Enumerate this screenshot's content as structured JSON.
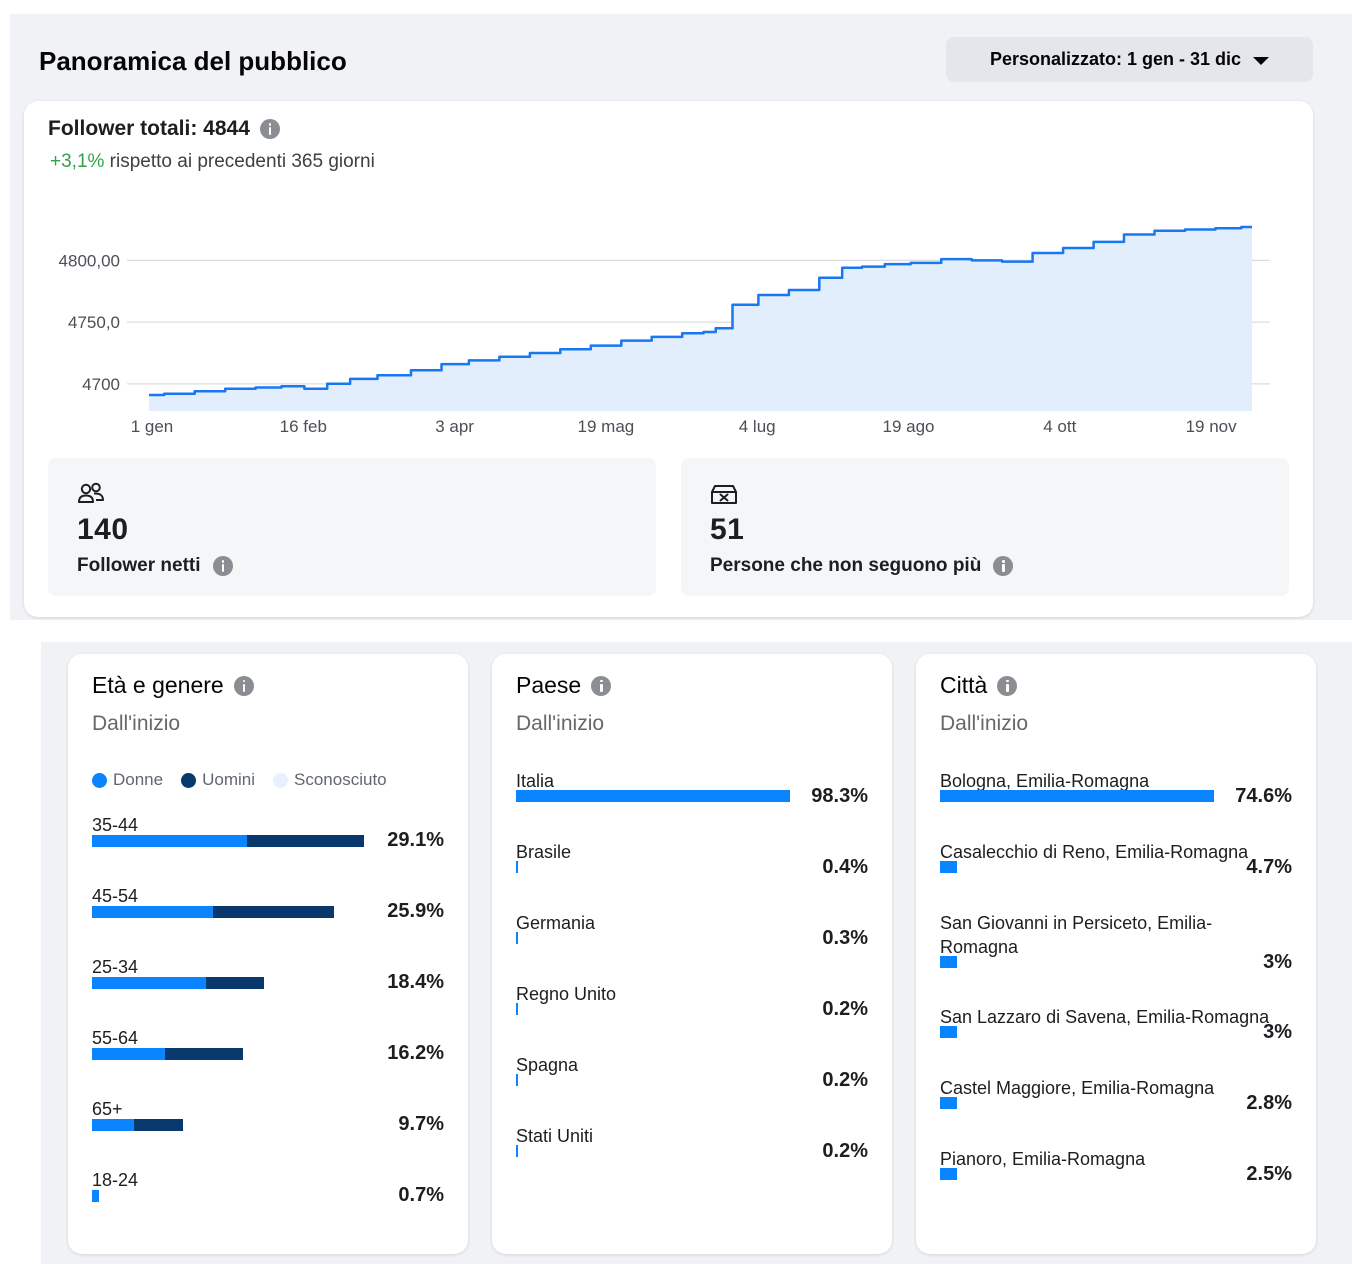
{
  "header": {
    "title": "Panoramica del pubblico",
    "date_range": "Personalizzato: 1 gen - 31 dic"
  },
  "overview": {
    "followers_total": "Follower totali: 4844",
    "change_positive": "+3,1%",
    "change_rest": " rispetto ai precedenti 365 giorni"
  },
  "chart_data": {
    "type": "area",
    "title": "",
    "xlabel": "",
    "ylabel": "",
    "x_ticks": [
      "1 gen",
      "16 feb",
      "3 apr",
      "19 mag",
      "4 lug",
      "19 ago",
      "4 ott",
      "19 nov"
    ],
    "y_ticks": [
      "4700",
      "4750,0",
      "4800,00"
    ],
    "y_tick_values": [
      4700,
      4750,
      4800
    ],
    "ylim": [
      4678,
      4840
    ],
    "grid": true,
    "series": [
      {
        "x_day": [
          0,
          10,
          20,
          30,
          40,
          47,
          55,
          62,
          70,
          80,
          92,
          100,
          110,
          120,
          130,
          140,
          150,
          160,
          170,
          180,
          184,
          188,
          195,
          205,
          215,
          225,
          230,
          238,
          245,
          255,
          265,
          275,
          285,
          295,
          305,
          315,
          325,
          335,
          345,
          355,
          362
        ],
        "values": [
          4691,
          4692,
          4694,
          4696,
          4697,
          4698,
          4696,
          4700,
          4704,
          4707,
          4711,
          4716,
          4719,
          4722,
          4725,
          4728,
          4731,
          4735,
          4738,
          4741,
          4742,
          4745,
          4764,
          4772,
          4776,
          4786,
          4794,
          4795,
          4797,
          4798,
          4801,
          4800,
          4799,
          4806,
          4810,
          4815,
          4821,
          4824,
          4825,
          4826,
          4827
        ]
      }
    ],
    "colors": {
      "line": "#1877f2",
      "fill": "#e3eefc"
    }
  },
  "stats": {
    "net": {
      "value": "140",
      "label": "Follower netti",
      "icon": "people-icon"
    },
    "unfollow": {
      "value": "51",
      "label": "Persone che non seguono più",
      "icon": "unfollow-box-icon"
    }
  },
  "age_gender": {
    "title": "Età e genere",
    "subtitle": "Dall'inizio",
    "legend": {
      "women": "Donne",
      "men": "Uomini",
      "unknown": "Sconosciuto"
    },
    "colors": {
      "women": "#0a84ff",
      "men": "#08386c",
      "unknown": "#e7f1fe"
    },
    "rows": [
      {
        "label": "35-44",
        "pct": "29.1%",
        "women": 57,
        "men": 43
      },
      {
        "label": "45-54",
        "pct": "25.9%",
        "women": 50,
        "men": 50
      },
      {
        "label": "25-34",
        "pct": "18.4%",
        "women": 66,
        "men": 34
      },
      {
        "label": "55-64",
        "pct": "16.2%",
        "women": 48,
        "men": 52
      },
      {
        "label": "65+",
        "pct": "9.7%",
        "women": 46,
        "men": 54
      },
      {
        "label": "18-24",
        "pct": "0.7%",
        "women": 100,
        "men": 0
      }
    ]
  },
  "country": {
    "title": "Paese",
    "subtitle": "Dall'inizio",
    "rows": [
      {
        "label": "Italia",
        "pct": "98.3%",
        "value": 98.3
      },
      {
        "label": "Brasile",
        "pct": "0.4%",
        "value": 0.4
      },
      {
        "label": "Germania",
        "pct": "0.3%",
        "value": 0.3
      },
      {
        "label": "Regno Unito",
        "pct": "0.2%",
        "value": 0.2
      },
      {
        "label": "Spagna",
        "pct": "0.2%",
        "value": 0.2
      },
      {
        "label": "Stati Uniti",
        "pct": "0.2%",
        "value": 0.2
      }
    ]
  },
  "city": {
    "title": "Città",
    "subtitle": "Dall'inizio",
    "rows": [
      {
        "label": "Bologna, Emilia-Romagna",
        "pct": "74.6%",
        "value": 74.6
      },
      {
        "label": "Casalecchio di Reno, Emilia-Romagna",
        "pct": "4.7%",
        "value": 4.7
      },
      {
        "label": "San Giovanni in Persiceto, Emilia-Romagna",
        "pct": "3%",
        "value": 3
      },
      {
        "label": "San Lazzaro di Savena, Emilia-Romagna",
        "pct": "3%",
        "value": 3
      },
      {
        "label": "Castel Maggiore, Emilia-Romagna",
        "pct": "2.8%",
        "value": 2.8
      },
      {
        "label": "Pianoro, Emilia-Romagna",
        "pct": "2.5%",
        "value": 2.5
      }
    ]
  }
}
